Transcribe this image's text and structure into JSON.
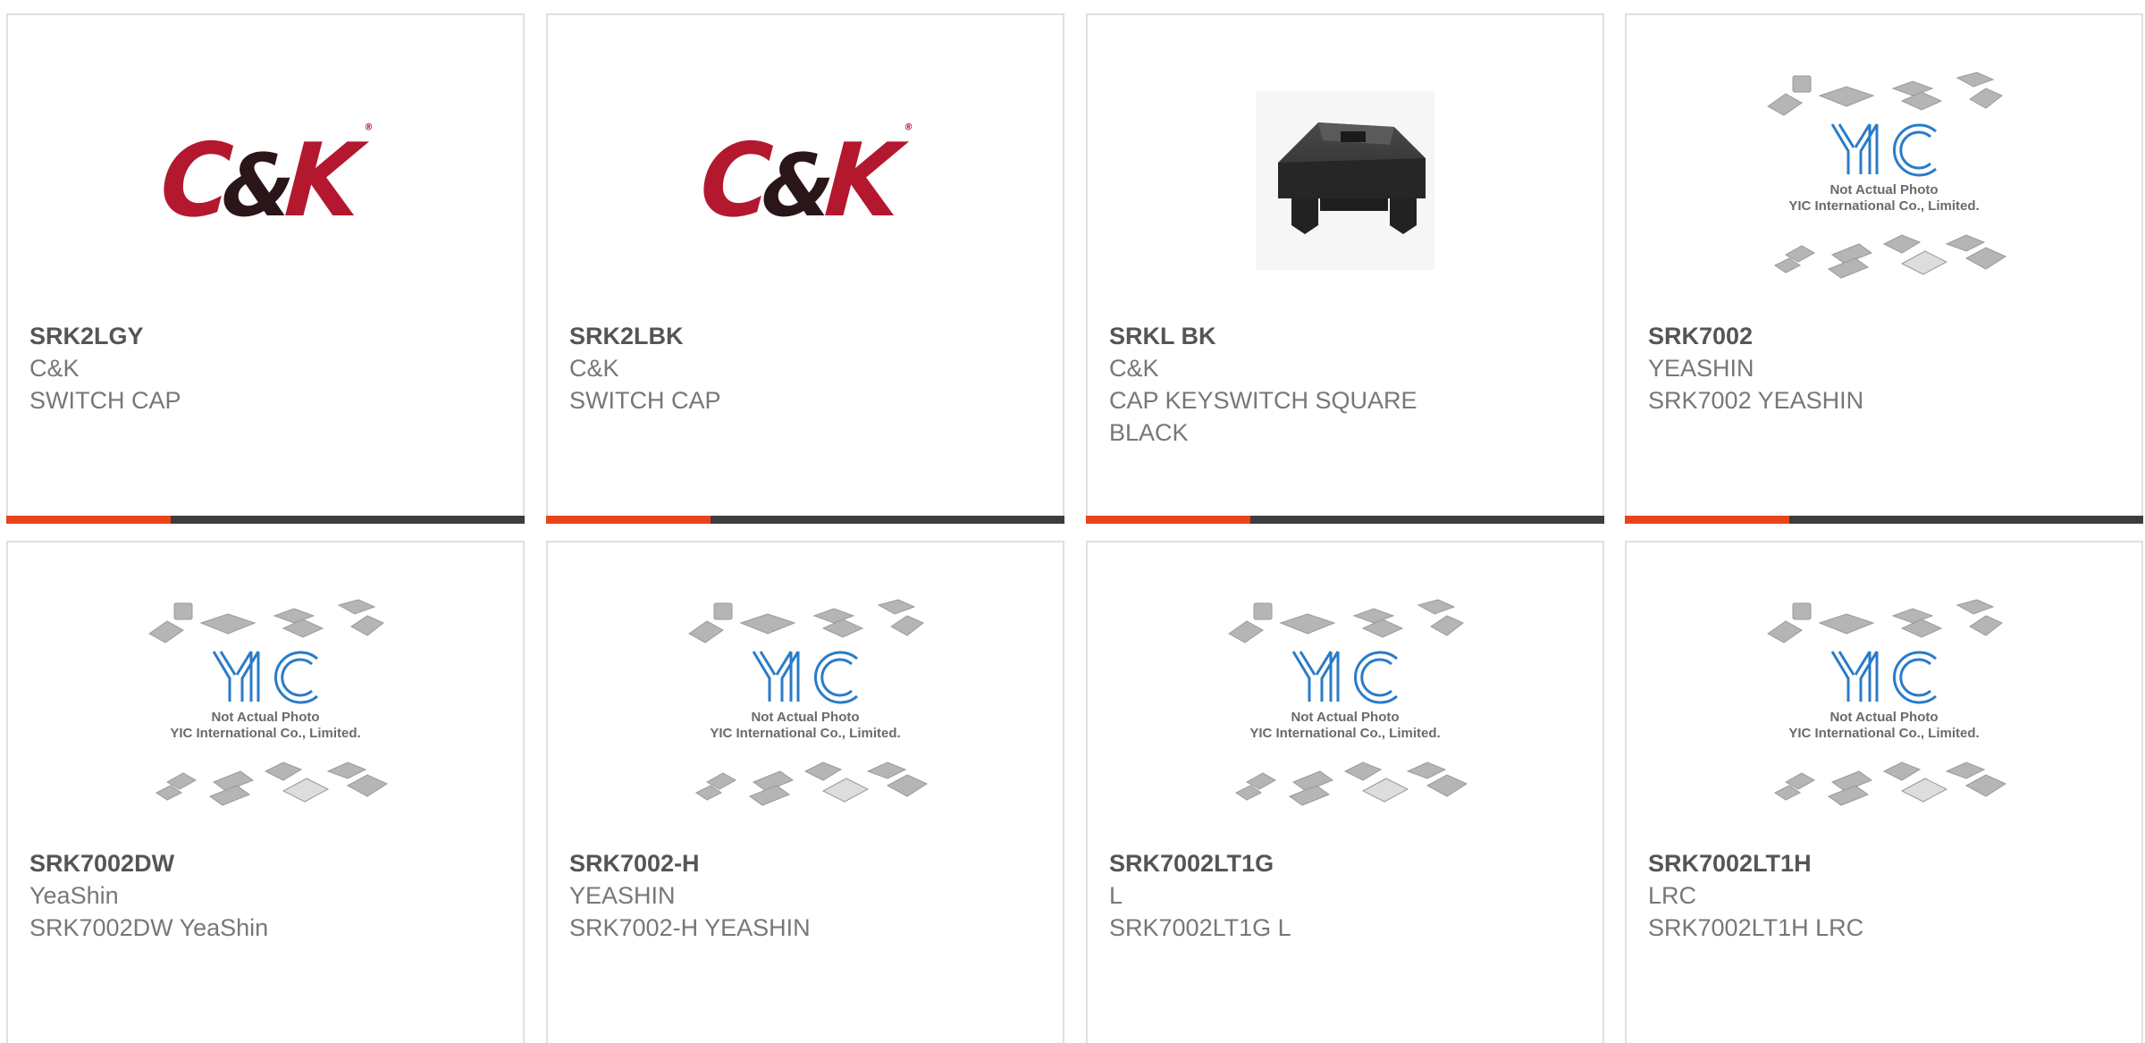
{
  "products": [
    {
      "part_number": "SRK2LGY",
      "manufacturer": "C&K",
      "description": "SWITCH CAP",
      "image": "ck-logo"
    },
    {
      "part_number": "SRK2LBK",
      "manufacturer": "C&K",
      "description": "SWITCH CAP",
      "image": "ck-logo"
    },
    {
      "part_number": "SRKL BK",
      "manufacturer": "C&K",
      "description": "CAP KEYSWITCH SQUARE BLACK",
      "image": "keyswitch-cap-photo"
    },
    {
      "part_number": "SRK7002",
      "manufacturer": "YEASHIN",
      "description": "SRK7002 YEASHIN",
      "image": "yic-placeholder"
    },
    {
      "part_number": "SRK7002DW",
      "manufacturer": "YeaShin",
      "description": "SRK7002DW YeaShin",
      "image": "yic-placeholder"
    },
    {
      "part_number": "SRK7002-H",
      "manufacturer": "YEASHIN",
      "description": "SRK7002-H YEASHIN",
      "image": "yic-placeholder"
    },
    {
      "part_number": "SRK7002LT1G",
      "manufacturer": "L",
      "description": "SRK7002LT1G L",
      "image": "yic-placeholder"
    },
    {
      "part_number": "SRK7002LT1H",
      "manufacturer": "LRC",
      "description": "SRK7002LT1H LRC",
      "image": "yic-placeholder"
    }
  ],
  "logo_text": {
    "ck": "C&K",
    "yic_line1": "Not Actual Photo",
    "yic_line2": "YIC International Co., Limited."
  },
  "colors": {
    "accent": "#e8441c",
    "bar": "#3d3d3d",
    "ck_red": "#b3182f",
    "yic_blue": "#2a7bc8"
  }
}
